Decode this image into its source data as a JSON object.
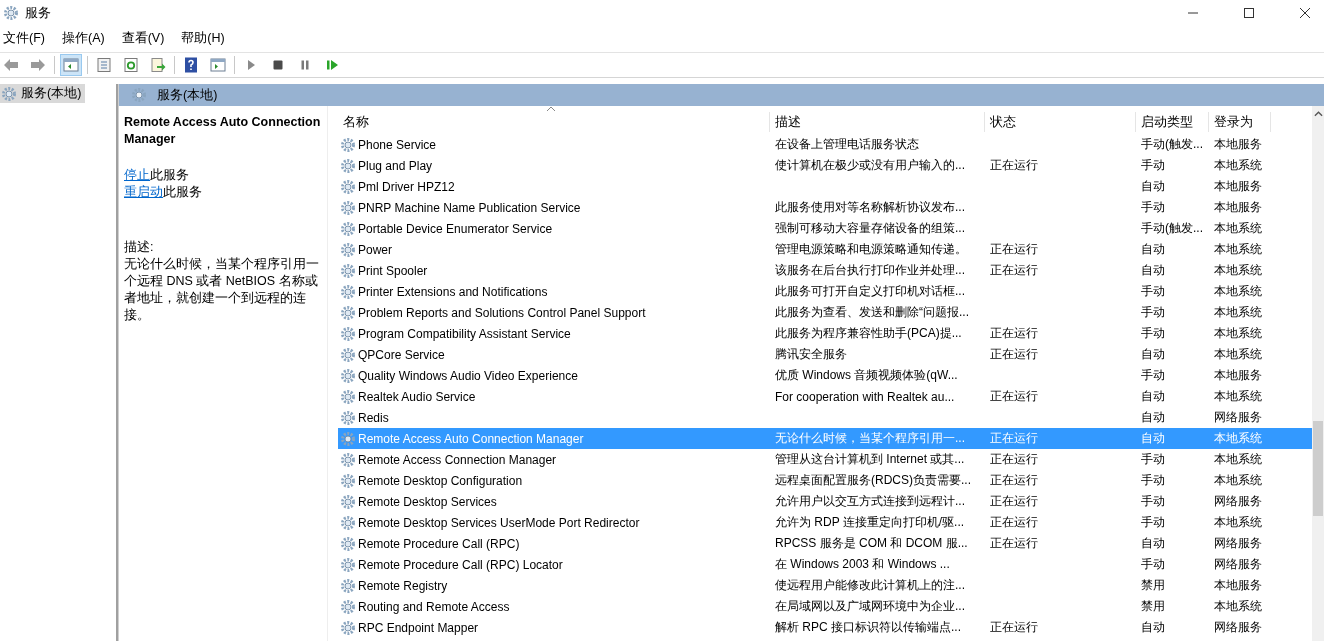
{
  "window": {
    "title": "服务"
  },
  "menu": [
    "文件(F)",
    "操作(A)",
    "查看(V)",
    "帮助(H)"
  ],
  "toolbar": [
    [
      {
        "kind": "back",
        "selected": false
      },
      {
        "kind": "forward",
        "selected": false
      }
    ],
    [
      {
        "kind": "tree",
        "selected": true
      }
    ],
    [
      {
        "kind": "properties",
        "selected": false
      },
      {
        "kind": "refresh",
        "selected": false
      },
      {
        "kind": "export",
        "selected": false
      }
    ],
    [
      {
        "kind": "help",
        "selected": false
      },
      {
        "kind": "actionpane",
        "selected": false
      }
    ],
    [
      {
        "kind": "play",
        "selected": false
      },
      {
        "kind": "stop",
        "selected": false
      },
      {
        "kind": "pause",
        "selected": false
      },
      {
        "kind": "resume",
        "selected": false
      }
    ]
  ],
  "tree": {
    "items": [
      {
        "label": "服务(本地)",
        "selected": true
      }
    ]
  },
  "pane_header": "服务(本地)",
  "detail": {
    "title": "Remote Access Auto Connection Manager",
    "actions": [
      {
        "link": "停止",
        "text": "此服务"
      },
      {
        "link": "重启动",
        "text": "此服务"
      }
    ],
    "description_label": "描述:",
    "description": "无论什么时候，当某个程序引用一个远程 DNS 或者 NetBIOS 名称或者地址，就创建一个到远程的连接。"
  },
  "table": {
    "columns": [
      "名称",
      "描述",
      "状态",
      "启动类型",
      "登录为"
    ],
    "rows": [
      {
        "name": "Phone Service",
        "description": "在设备上管理电话服务状态",
        "status": "",
        "startup": "手动(触发...",
        "logon": "本地服务",
        "selected": false
      },
      {
        "name": "Plug and Play",
        "description": "使计算机在极少或没有用户输入的...",
        "status": "正在运行",
        "startup": "手动",
        "logon": "本地系统",
        "selected": false
      },
      {
        "name": "Pml Driver HPZ12",
        "description": "",
        "status": "",
        "startup": "自动",
        "logon": "本地服务",
        "selected": false
      },
      {
        "name": "PNRP Machine Name Publication Service",
        "description": "此服务使用对等名称解析协议发布...",
        "status": "",
        "startup": "手动",
        "logon": "本地服务",
        "selected": false
      },
      {
        "name": "Portable Device Enumerator Service",
        "description": "强制可移动大容量存储设备的组策...",
        "status": "",
        "startup": "手动(触发...",
        "logon": "本地系统",
        "selected": false
      },
      {
        "name": "Power",
        "description": "管理电源策略和电源策略通知传递。",
        "status": "正在运行",
        "startup": "自动",
        "logon": "本地系统",
        "selected": false
      },
      {
        "name": "Print Spooler",
        "description": "该服务在后台执行打印作业并处理...",
        "status": "正在运行",
        "startup": "自动",
        "logon": "本地系统",
        "selected": false
      },
      {
        "name": "Printer Extensions and Notifications",
        "description": "此服务可打开自定义打印机对话框...",
        "status": "",
        "startup": "手动",
        "logon": "本地系统",
        "selected": false
      },
      {
        "name": "Problem Reports and Solutions Control Panel Support",
        "description": "此服务为查看、发送和删除“问题报...",
        "status": "",
        "startup": "手动",
        "logon": "本地系统",
        "selected": false
      },
      {
        "name": "Program Compatibility Assistant Service",
        "description": "此服务为程序兼容性助手(PCA)提...",
        "status": "正在运行",
        "startup": "手动",
        "logon": "本地系统",
        "selected": false
      },
      {
        "name": "QPCore Service",
        "description": "腾讯安全服务",
        "status": "正在运行",
        "startup": "自动",
        "logon": "本地系统",
        "selected": false
      },
      {
        "name": "Quality Windows Audio Video Experience",
        "description": "优质 Windows 音频视频体验(qW...",
        "status": "",
        "startup": "手动",
        "logon": "本地服务",
        "selected": false
      },
      {
        "name": "Realtek Audio Service",
        "description": "For cooperation with Realtek au...",
        "status": "正在运行",
        "startup": "自动",
        "logon": "本地系统",
        "selected": false
      },
      {
        "name": "Redis",
        "description": "",
        "status": "",
        "startup": "自动",
        "logon": "网络服务",
        "selected": false
      },
      {
        "name": "Remote Access Auto Connection Manager",
        "description": "无论什么时候，当某个程序引用一...",
        "status": "正在运行",
        "startup": "自动",
        "logon": "本地系统",
        "selected": true
      },
      {
        "name": "Remote Access Connection Manager",
        "description": "管理从这台计算机到 Internet 或其...",
        "status": "正在运行",
        "startup": "手动",
        "logon": "本地系统",
        "selected": false
      },
      {
        "name": "Remote Desktop Configuration",
        "description": "远程桌面配置服务(RDCS)负责需要...",
        "status": "正在运行",
        "startup": "手动",
        "logon": "本地系统",
        "selected": false
      },
      {
        "name": "Remote Desktop Services",
        "description": "允许用户以交互方式连接到远程计...",
        "status": "正在运行",
        "startup": "手动",
        "logon": "网络服务",
        "selected": false
      },
      {
        "name": "Remote Desktop Services UserMode Port Redirector",
        "description": "允许为 RDP 连接重定向打印机/驱...",
        "status": "正在运行",
        "startup": "手动",
        "logon": "本地系统",
        "selected": false
      },
      {
        "name": "Remote Procedure Call (RPC)",
        "description": "RPCSS 服务是 COM 和 DCOM 服...",
        "status": "正在运行",
        "startup": "自动",
        "logon": "网络服务",
        "selected": false
      },
      {
        "name": "Remote Procedure Call (RPC) Locator",
        "description": "在 Windows 2003 和 Windows ...",
        "status": "",
        "startup": "手动",
        "logon": "网络服务",
        "selected": false
      },
      {
        "name": "Remote Registry",
        "description": "使远程用户能修改此计算机上的注...",
        "status": "",
        "startup": "禁用",
        "logon": "本地服务",
        "selected": false
      },
      {
        "name": "Routing and Remote Access",
        "description": "在局域网以及广域网环境中为企业...",
        "status": "",
        "startup": "禁用",
        "logon": "本地系统",
        "selected": false
      },
      {
        "name": "RPC Endpoint Mapper",
        "description": "解析 RPC 接口标识符以传输端点...",
        "status": "正在运行",
        "startup": "自动",
        "logon": "网络服务",
        "selected": false
      }
    ]
  }
}
